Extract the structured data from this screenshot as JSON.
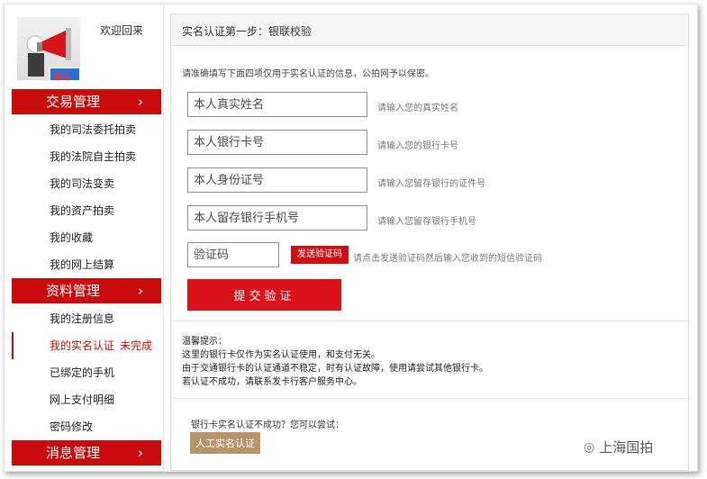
{
  "sidebar": {
    "welcome": "欢迎回来",
    "badge": "未认证",
    "sections": [
      {
        "label": "交易管理",
        "chevron": "›",
        "items": [
          "我的司法委托拍卖",
          "我的法院自主拍卖",
          "我的司法变卖",
          "我的资产拍卖",
          "我的收藏",
          "我的网上结算"
        ]
      },
      {
        "label": "资料管理",
        "chevron": "›",
        "items": [
          "我的注册信息",
          "我的实名认证",
          "已绑定的手机",
          "网上支付明细",
          "密码修改"
        ]
      },
      {
        "label": "消息管理",
        "chevron": "›",
        "items": []
      }
    ],
    "active_status": "未完成"
  },
  "main": {
    "title": "实名认证第一步：银联校验",
    "intro": "请准确填写下面四项仅用于实名认证的信息，公拍网予以保密。",
    "fields": [
      {
        "placeholder": "本人真实姓名",
        "hint": "请输入您的真实姓名"
      },
      {
        "placeholder": "本人银行卡号",
        "hint": "请输入您的银行卡号"
      },
      {
        "placeholder": "本人身份证号",
        "hint": "请输入您留存银行的证件号"
      },
      {
        "placeholder": "本人留存银行手机号",
        "hint": "请输入您留存银行手机号"
      }
    ],
    "code": {
      "placeholder": "验证码",
      "send_label": "发送验证码",
      "hint": "请点击发送验证码然后输入您收到的短信验证码"
    },
    "submit_label": "提交验证",
    "tips": [
      "温馨提示：",
      "这里的银行卡仅作为实名认证使用，和支付无关。",
      "由于交通银行卡的认证通道不稳定，时有认证故障，使用请尝试其他银行卡。",
      "若认证不成功，请联系发卡行客户服务中心。"
    ],
    "alt_prompt": "银行卡实名认证不成功？您可以尝试：",
    "manual_label": "人工实名认证"
  },
  "watermark": "上海国拍",
  "colors": {
    "accent_red": "#c80c0c",
    "manual_btn": "#b7956a"
  }
}
